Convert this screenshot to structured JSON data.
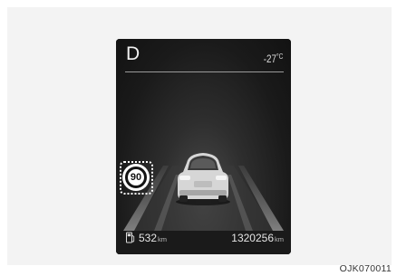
{
  "cluster": {
    "gear": "D",
    "outside_temp": "-27",
    "temp_unit": "°C",
    "speed_limit": "90",
    "range_value": "532",
    "range_unit": "km",
    "odometer_value": "1320256",
    "odometer_unit": "km"
  },
  "icons": {
    "fuel": "fuel-pump-icon",
    "speed_limit": "speed-limit-sign-icon",
    "car": "vehicle-rear-view-icon"
  },
  "colors": {
    "screen_bg": "#141414",
    "text": "#e6e6e6",
    "frame": "#f3f3f3"
  },
  "caption": "OJK070011"
}
